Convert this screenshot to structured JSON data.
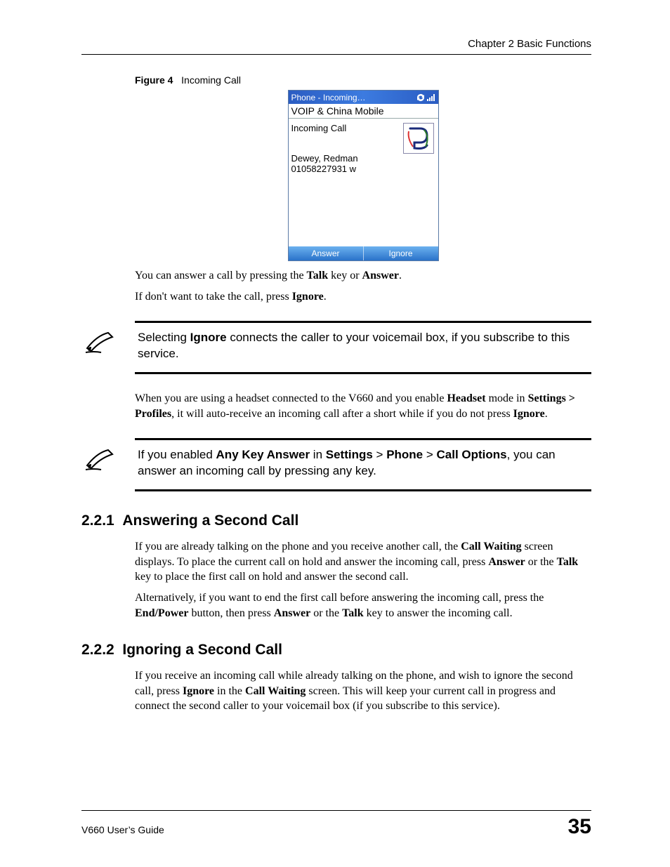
{
  "header": {
    "chapter": "Chapter 2 Basic Functions"
  },
  "figure": {
    "label": "Figure 4",
    "caption": "Incoming Call",
    "phone": {
      "titlebar": "Phone - Incoming…",
      "subtitle": "VOIP & China Mobile",
      "status": "Incoming Call",
      "caller_name": "Dewey, Redman",
      "caller_number": "01058227931 w",
      "soft_left": "Answer",
      "soft_right": "Ignore"
    }
  },
  "para1_a": "You can answer a call by pressing the ",
  "para1_key1": "Talk",
  "para1_b": " key or ",
  "para1_key2": "Answer",
  "para1_c": ".",
  "para2_a": "If don't want to take the call, press ",
  "para2_key": "Ignore",
  "para2_b": ".",
  "note1_a": "Selecting ",
  "note1_key": "Ignore",
  "note1_b": " connects the caller to your voicemail box, if you subscribe to this service.",
  "para3_a": "When you are using a headset connected to the V660 and you enable ",
  "para3_key1": "Headset",
  "para3_b": " mode in ",
  "para3_key2": "Settings > Profiles",
  "para3_c": ", it will auto-receive an incoming call after a short while if you do not press ",
  "para3_key3": "Ignore",
  "para3_d": ".",
  "note2_a": "If you enabled ",
  "note2_k1": "Any Key Answer",
  "note2_b": " in ",
  "note2_k2": "Settings",
  "note2_c": " > ",
  "note2_k3": "Phone",
  "note2_d": " > ",
  "note2_k4": "Call Options",
  "note2_e": ", you can answer an incoming call by pressing any key.",
  "sec1": {
    "num": "2.2.1",
    "title": "Answering a Second Call"
  },
  "sec1_p1_a": "If you are already talking on the phone and you receive another call, the ",
  "sec1_p1_k1": "Call Waiting",
  "sec1_p1_b": " screen displays. To place the current call on hold and answer the incoming call, press ",
  "sec1_p1_k2": "Answer",
  "sec1_p1_c": " or the ",
  "sec1_p1_k3": "Talk",
  "sec1_p1_d": " key to place the first call on hold and answer the second call.",
  "sec1_p2_a": "Alternatively, if you want to end the first call before answering the incoming call, press the ",
  "sec1_p2_k1": "End/Power",
  "sec1_p2_b": " button, then press ",
  "sec1_p2_k2": "Answer",
  "sec1_p2_c": " or the ",
  "sec1_p2_k3": "Talk",
  "sec1_p2_d": " key to answer the incoming call.",
  "sec2": {
    "num": "2.2.2",
    "title": "Ignoring a Second Call"
  },
  "sec2_p1_a": "If you receive an incoming call while already talking on the phone, and wish to ignore the second call, press ",
  "sec2_p1_k1": "Ignore",
  "sec2_p1_b": " in the ",
  "sec2_p1_k2": "Call Waiting",
  "sec2_p1_c": " screen. This will keep your current call in progress and connect the second caller to your voicemail box (if you subscribe to this service).",
  "footer": {
    "guide": "V660 User’s Guide",
    "page": "35"
  }
}
